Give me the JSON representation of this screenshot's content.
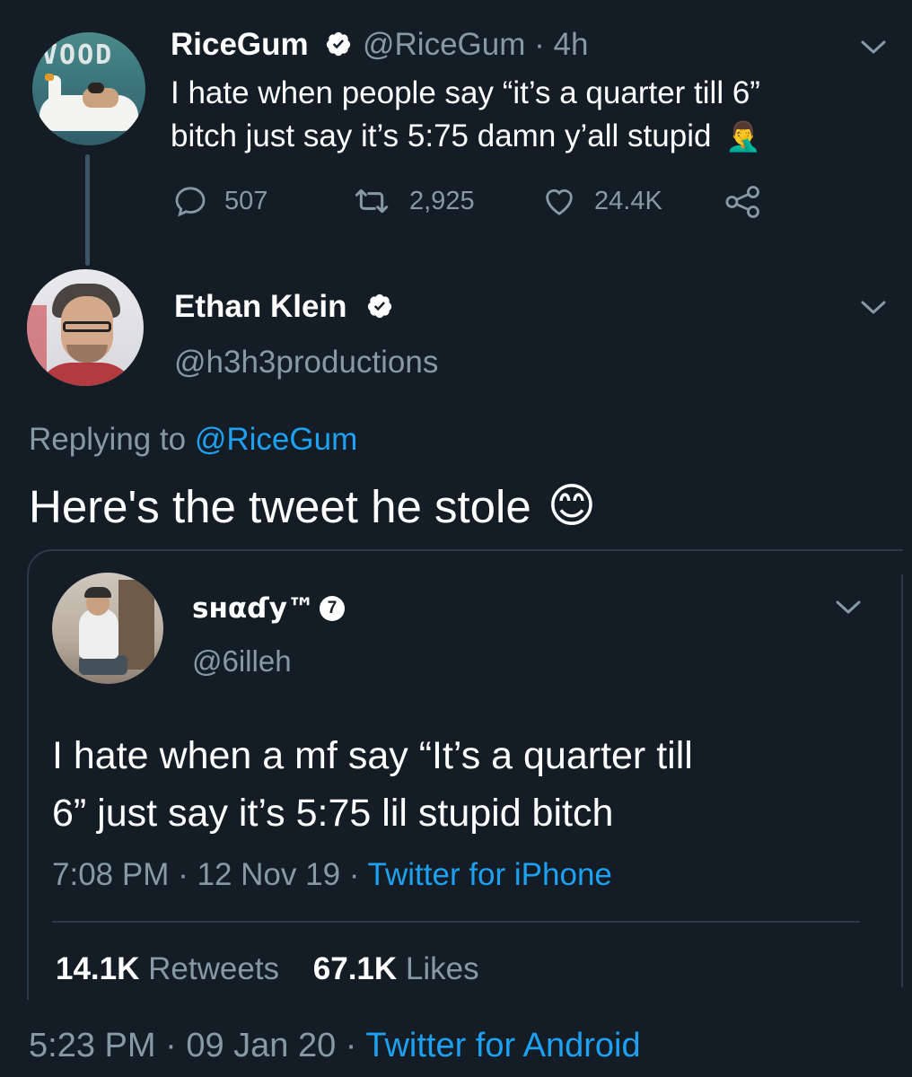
{
  "tweet1": {
    "name": "RiceGum",
    "handle": "@RiceGum",
    "time": "· 4h",
    "line1": "I hate when people say “it’s a quarter till 6”",
    "line2": "bitch just say it’s 5:75 damn y’all stupid",
    "emoji": "🤦‍♂️",
    "replies": "507",
    "retweets": "2,925",
    "likes": "24.4K"
  },
  "tweet2": {
    "name": "Ethan Klein",
    "handle": "@h3h3productions",
    "replying_prefix": "Replying to ",
    "replying_to": "@RiceGum",
    "text": "Here's the tweet he stole",
    "emoji": "😊"
  },
  "quoted": {
    "name": "ѕнαɗу™",
    "badge": "7",
    "handle": "@6illeh",
    "line1": "I hate when a mf say “It’s a quarter till",
    "line2": "6” just say it’s 5:75 lil stupid bitch",
    "time": "7:08 PM",
    "date": "12 Nov 19",
    "source": "Twitter for iPhone",
    "retweets_count": "14.1K",
    "retweets_label": "Retweets",
    "likes_count": "67.1K",
    "likes_label": "Likes"
  },
  "footer": {
    "time": "5:23 PM",
    "date": "09 Jan 20",
    "source": "Twitter for Android"
  },
  "colors": {
    "background": "#141d26",
    "secondary_text": "#8899a6",
    "link": "#1da1f2"
  }
}
